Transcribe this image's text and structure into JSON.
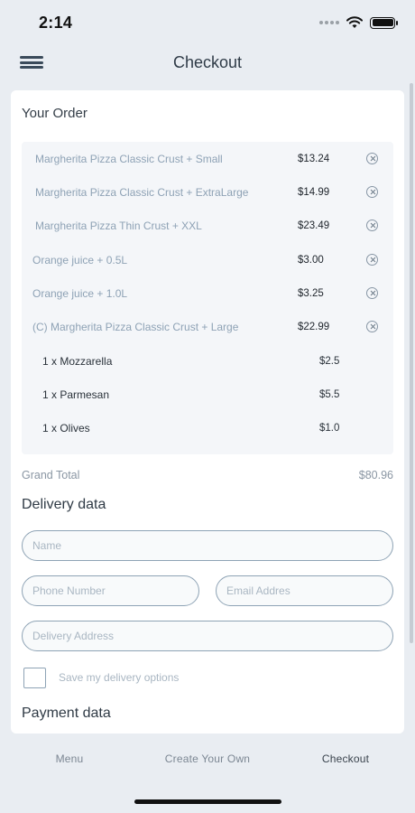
{
  "status": {
    "time": "2:14"
  },
  "header": {
    "title": "Checkout"
  },
  "order": {
    "heading": "Your Order",
    "items": [
      {
        "name": "Margherita Pizza  Classic Crust + Small",
        "price": "$13.24"
      },
      {
        "name": "Margherita Pizza  Classic Crust + ExtraLarge",
        "price": "$14.99"
      },
      {
        "name": "Margherita Pizza  Thin Crust + XXL",
        "price": "$23.49"
      },
      {
        "name": "Orange juice + 0.5L",
        "price": "$3.00"
      },
      {
        "name": "Orange juice + 1.0L",
        "price": "$3.25"
      },
      {
        "name": "(C) Margherita Pizza  Classic Crust + Large",
        "price": "$22.99"
      }
    ],
    "toppings": [
      {
        "name": "1 x Mozzarella",
        "price": "$2.5"
      },
      {
        "name": "1 x Parmesan",
        "price": "$5.5"
      },
      {
        "name": "1 x Olives",
        "price": "$1.0"
      }
    ],
    "grand_total_label": "Grand Total",
    "grand_total_value": "$80.96"
  },
  "delivery": {
    "title": "Delivery data",
    "name_placeholder": "Name",
    "phone_placeholder": "Phone Number",
    "email_placeholder": "Email Addres",
    "address_placeholder": "Delivery Address",
    "save_label": "Save my delivery options"
  },
  "payment": {
    "title": "Payment data"
  },
  "tabs": [
    {
      "label": "Menu"
    },
    {
      "label": "Create Your Own"
    },
    {
      "label": "Checkout"
    }
  ],
  "colors": {
    "accent": "#8ea3b5",
    "background": "#e9edf2",
    "order_box": "#f4f6f9"
  }
}
